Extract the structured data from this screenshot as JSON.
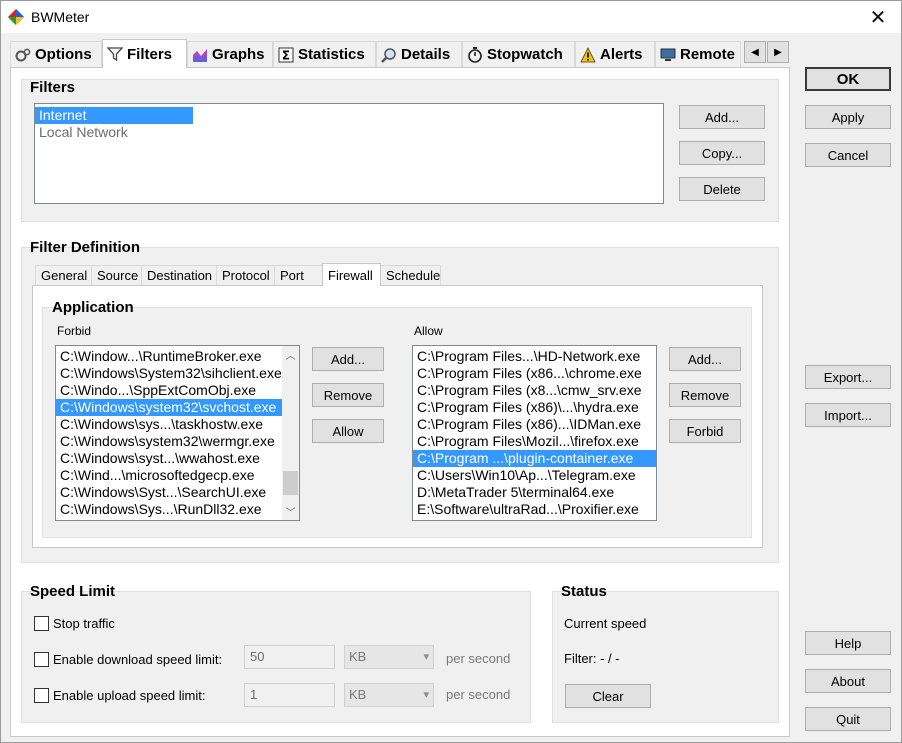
{
  "window": {
    "title": "BWMeter"
  },
  "tabs": [
    {
      "label": "Options",
      "icon": "gear-icon"
    },
    {
      "label": "Filters",
      "icon": "funnel-icon"
    },
    {
      "label": "Graphs",
      "icon": "graph-icon"
    },
    {
      "label": "Statistics",
      "icon": "sigma-icon"
    },
    {
      "label": "Details",
      "icon": "magnifier-icon"
    },
    {
      "label": "Stopwatch",
      "icon": "stopwatch-icon"
    },
    {
      "label": "Alerts",
      "icon": "warning-icon"
    },
    {
      "label": "Remote",
      "icon": "monitor-icon"
    }
  ],
  "filters": {
    "title": "Filters",
    "items": [
      "Internet",
      "Local Network"
    ],
    "add": "Add...",
    "copy": "Copy...",
    "delete": "Delete"
  },
  "definition": {
    "title": "Filter Definition",
    "subtabs": [
      "General",
      "Source",
      "Destination",
      "Protocol",
      "Port",
      "Firewall",
      "Schedule"
    ]
  },
  "application": {
    "title": "Application",
    "forbid_label": "Forbid",
    "allow_label": "Allow",
    "forbid_items": [
      "C:\\Window...\\RuntimeBroker.exe",
      "C:\\Windows\\System32\\sihclient.exe",
      "C:\\Windo...\\SppExtComObj.exe",
      "C:\\Windows\\system32\\svchost.exe",
      "C:\\Windows\\sys...\\taskhostw.exe",
      "C:\\Windows\\system32\\wermgr.exe",
      "C:\\Windows\\syst...\\wwahost.exe",
      "C:\\Wind...\\microsoftedgecp.exe",
      "C:\\Windows\\Syst...\\SearchUI.exe",
      "C:\\Windows\\Sys...\\RunDll32.exe"
    ],
    "allow_items": [
      "C:\\Program Files...\\HD-Network.exe",
      "C:\\Program Files (x86...\\chrome.exe",
      "C:\\Program Files (x8...\\cmw_srv.exe",
      "C:\\Program Files (x86)\\...\\hydra.exe",
      "C:\\Program Files (x86)...\\IDMan.exe",
      "C:\\Program Files\\Mozil...\\firefox.exe",
      "C:\\Program ...\\plugin-container.exe",
      "C:\\Users\\Win10\\Ap...\\Telegram.exe",
      "D:\\MetaTrader 5\\terminal64.exe",
      "E:\\Software\\ultraRad...\\Proxifier.exe"
    ],
    "forbid_add": "Add...",
    "forbid_remove": "Remove",
    "forbid_allow": "Allow",
    "allow_add": "Add...",
    "allow_remove": "Remove",
    "allow_forbid": "Forbid"
  },
  "speed": {
    "title": "Speed Limit",
    "stop_traffic": "Stop traffic",
    "download_label": "Enable download speed limit:",
    "upload_label": "Enable upload speed limit:",
    "download_value": "50",
    "upload_value": "1",
    "unit": "KB",
    "per_second": "per second"
  },
  "status": {
    "title": "Status",
    "current_speed": "Current speed",
    "filter_line": "Filter: - / -",
    "clear": "Clear"
  },
  "side_buttons": {
    "ok": "OK",
    "apply": "Apply",
    "cancel": "Cancel",
    "export": "Export...",
    "import": "Import...",
    "help": "Help",
    "about": "About",
    "quit": "Quit"
  }
}
